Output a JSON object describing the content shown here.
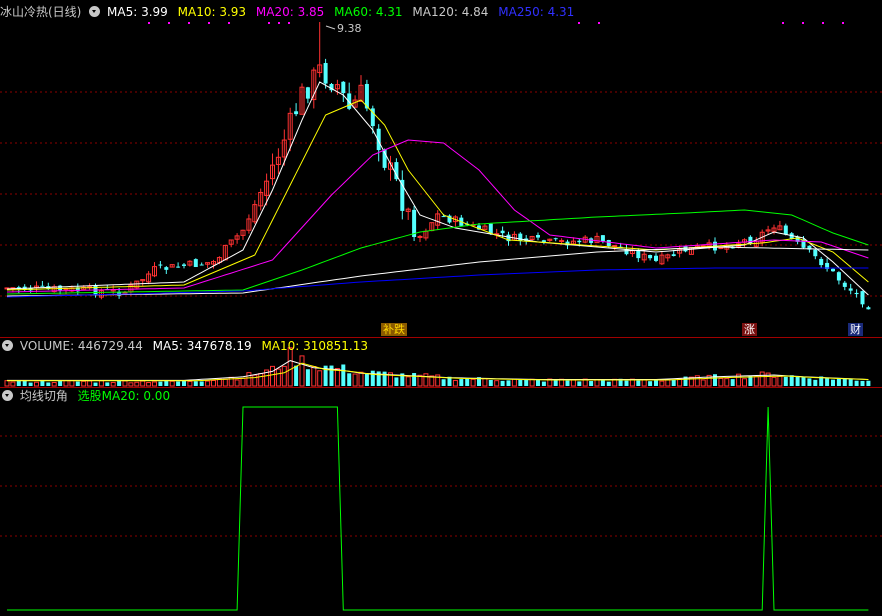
{
  "main_header": {
    "title": "冰山冷热(日线)",
    "ma5": "MA5: 3.99",
    "ma10": "MA10: 3.93",
    "ma20": "MA20: 3.85",
    "ma60": "MA60: 4.31",
    "ma120": "MA120: 4.84",
    "ma250": "MA250: 4.31"
  },
  "high_label": "9.38",
  "events": [
    {
      "label": "补跌",
      "color": "#ffd700"
    },
    {
      "label": "涨",
      "color": "#ff4040"
    },
    {
      "label": "财",
      "color": "#ffffff"
    }
  ],
  "volume_header": {
    "volume": "VOLUME: 446729.44",
    "ma5": "MA5: 347678.19",
    "ma10": "MA10: 310851.13"
  },
  "indicator_header": {
    "title": "均线切角",
    "signal": "选股MA20: 0.00"
  },
  "colors": {
    "up": "#ff3232",
    "down": "#54ffff",
    "ma5": "#ffffff",
    "ma10": "#ffff00",
    "ma20": "#ff00ff",
    "ma60": "#00ff00",
    "ma120": "#ffffff",
    "ma250": "#0000ff",
    "grid": "#8b0000",
    "indicator": "#00ff00"
  },
  "chart_data": {
    "type": "candlestick",
    "high_marker": 9.38,
    "indicator_signal": [
      {
        "from_bar": 0,
        "to_bar": 39,
        "value": 0
      },
      {
        "from_bar": 40,
        "to_bar": 56,
        "value": 1
      },
      {
        "from_bar": 57,
        "to_bar": 128,
        "value": 0
      },
      {
        "from_bar": 129,
        "to_bar": 129,
        "value": 1
      },
      {
        "from_bar": 130,
        "to_bar": 146,
        "value": 0
      }
    ]
  }
}
